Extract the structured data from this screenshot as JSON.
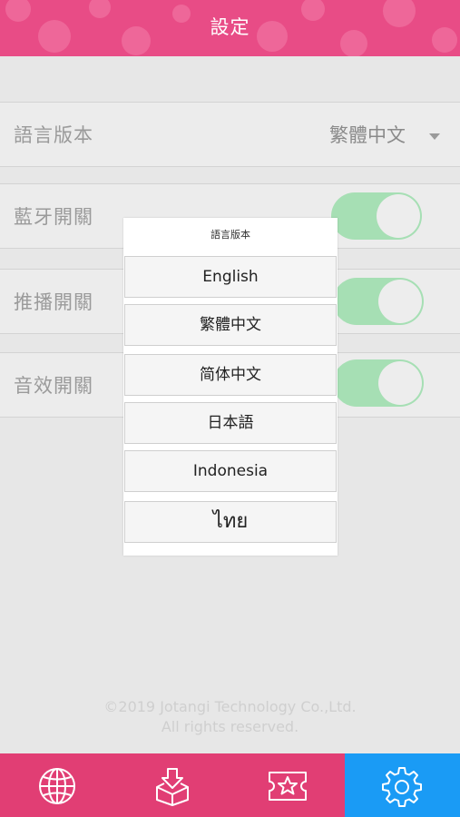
{
  "header": {
    "title": "設定"
  },
  "settings": {
    "language": {
      "label": "語言版本",
      "value": "繁體中文"
    },
    "bluetooth": {
      "label": "藍牙開關",
      "on": true
    },
    "push": {
      "label": "推播開關",
      "on": true
    },
    "sound": {
      "label": "音效開關",
      "on": true
    }
  },
  "language_picker": {
    "title": "語言版本",
    "options": [
      "English",
      "繁體中文",
      "简体中文",
      "日本語",
      "Indonesia",
      "ไทย"
    ]
  },
  "footer": {
    "copyright": "©2019 Jotangi Technology Co.,Ltd.",
    "rights": "All rights reserved."
  },
  "tabbar": {
    "tabs": [
      {
        "icon": "globe-icon",
        "active": false
      },
      {
        "icon": "download-box-icon",
        "active": false
      },
      {
        "icon": "star-ticket-icon",
        "active": false
      },
      {
        "icon": "gear-icon",
        "active": true
      }
    ]
  },
  "colors": {
    "header_pink": "#e84c86",
    "tabbar_pink": "#e13e74",
    "active_blue": "#1a9bf5",
    "toggle_green": "#a6dfb4"
  }
}
